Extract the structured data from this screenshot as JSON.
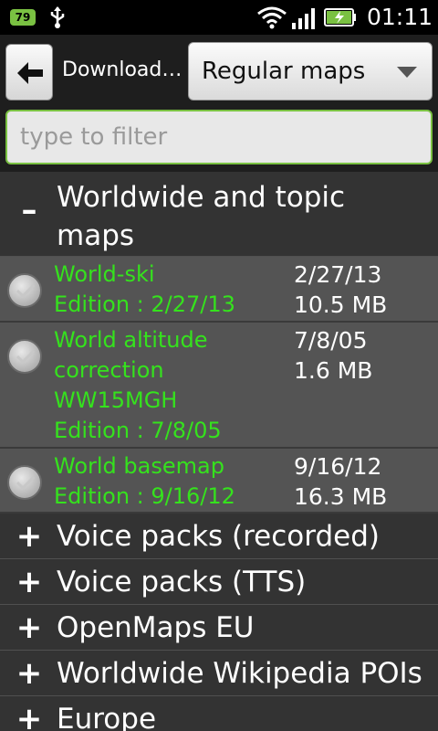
{
  "status_bar": {
    "battery_badge": "79",
    "time": "01:11",
    "icons": [
      "usb-icon",
      "wifi-icon",
      "signal-icon",
      "battery-charging-icon"
    ]
  },
  "toolbar": {
    "back_icon": "back-arrow-icon",
    "title": "Download…",
    "map_type_selected": "Regular maps",
    "dropdown_icon": "chevron-down-icon"
  },
  "filter": {
    "placeholder": "type to filter",
    "value": ""
  },
  "groups": [
    {
      "sign": "–",
      "label_line1": "Worldwide and topic",
      "label_line2": "maps",
      "expanded": true
    },
    {
      "sign": "+",
      "label": "Voice packs (recorded)",
      "expanded": false
    },
    {
      "sign": "+",
      "label": "Voice packs (TTS)",
      "expanded": false
    },
    {
      "sign": "+",
      "label": "OpenMaps EU",
      "expanded": false
    },
    {
      "sign": "+",
      "label": "Worldwide Wikipedia POIs",
      "expanded": false
    },
    {
      "sign": "+",
      "label": "Europe",
      "expanded": false
    }
  ],
  "items": [
    {
      "name_lines": [
        "World-ski",
        "Edition : 2/27/13"
      ],
      "date": "2/27/13",
      "size": "10.5 MB",
      "checked": false
    },
    {
      "name_lines": [
        "World altitude",
        "correction",
        "WW15MGH",
        "Edition : 7/8/05"
      ],
      "date": "7/8/05",
      "size": "1.6 MB",
      "checked": false
    },
    {
      "name_lines": [
        "World basemap",
        "Edition : 9/16/12"
      ],
      "date": "9/16/12",
      "size": "16.3 MB",
      "checked": false
    }
  ],
  "colors": {
    "accent_green": "#35e21d",
    "input_border": "#7ac142",
    "group_bg": "#333333",
    "item_bg": "#545454"
  }
}
